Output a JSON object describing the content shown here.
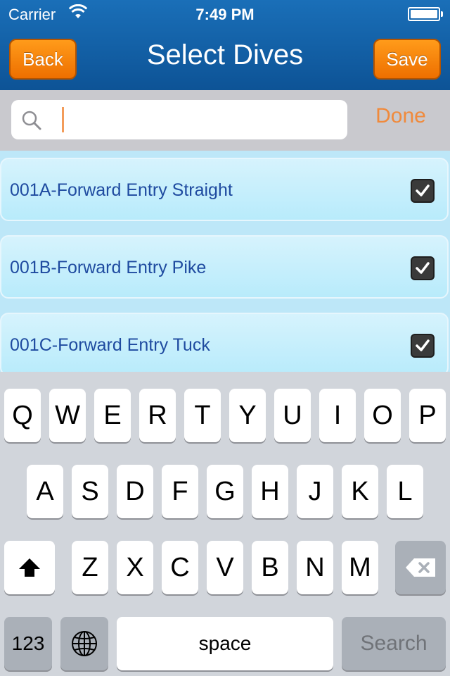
{
  "status": {
    "carrier": "Carrier",
    "time": "7:49 PM"
  },
  "nav": {
    "title": "Select Dives",
    "back_label": "Back",
    "save_label": "Save",
    "accent_color": "#f07d10"
  },
  "search": {
    "value": "",
    "placeholder": "",
    "done_label": "Done"
  },
  "dives": [
    {
      "label": "001A-Forward Entry Straight",
      "checked": true
    },
    {
      "label": "001B-Forward Entry Pike",
      "checked": true
    },
    {
      "label": "001C-Forward Entry Tuck",
      "checked": true
    }
  ],
  "keyboard": {
    "row1": [
      "Q",
      "W",
      "E",
      "R",
      "T",
      "Y",
      "U",
      "I",
      "O",
      "P"
    ],
    "row2": [
      "A",
      "S",
      "D",
      "F",
      "G",
      "H",
      "J",
      "K",
      "L"
    ],
    "row3": [
      "Z",
      "X",
      "C",
      "V",
      "B",
      "N",
      "M"
    ],
    "numbers_label": "123",
    "space_label": "space",
    "search_label": "Search",
    "shift_icon": "shift-icon",
    "globe_icon": "globe-icon",
    "backspace_icon": "backspace-icon"
  }
}
